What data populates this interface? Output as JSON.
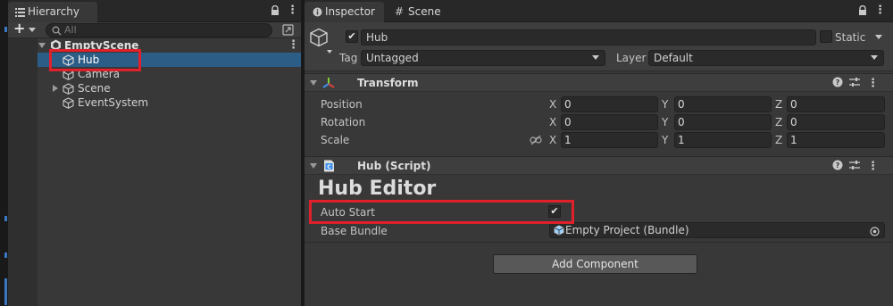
{
  "hierarchy": {
    "tab_label": "Hierarchy",
    "search_placeholder": "All",
    "scene_name": "EmptyScene",
    "items": [
      {
        "label": "Hub"
      },
      {
        "label": "Camera"
      },
      {
        "label": "Scene"
      },
      {
        "label": "EventSystem"
      }
    ]
  },
  "inspector": {
    "tab_label": "Inspector",
    "scene_tab_label": "Scene",
    "object_name": "Hub",
    "static_label": "Static",
    "tag_label": "Tag",
    "tag_value": "Untagged",
    "layer_label": "Layer",
    "layer_value": "Default",
    "transform": {
      "title": "Transform",
      "rows": [
        {
          "label": "Position",
          "x": "0",
          "y": "0",
          "z": "0"
        },
        {
          "label": "Rotation",
          "x": "0",
          "y": "0",
          "z": "0"
        },
        {
          "label": "Scale",
          "x": "1",
          "y": "1",
          "z": "1"
        }
      ],
      "axis_x": "X",
      "axis_y": "Y",
      "axis_z": "Z"
    },
    "script": {
      "title": "Hub (Script)",
      "editor_title": "Hub Editor",
      "auto_start_label": "Auto Start",
      "auto_start_check": "✔",
      "base_bundle_label": "Base Bundle",
      "base_bundle_value": "Empty Project (Bundle)"
    },
    "add_component_label": "Add Component"
  },
  "colors": {
    "selection": "#2c5d87",
    "highlight_box": "#e0202a",
    "panel": "#383838"
  }
}
